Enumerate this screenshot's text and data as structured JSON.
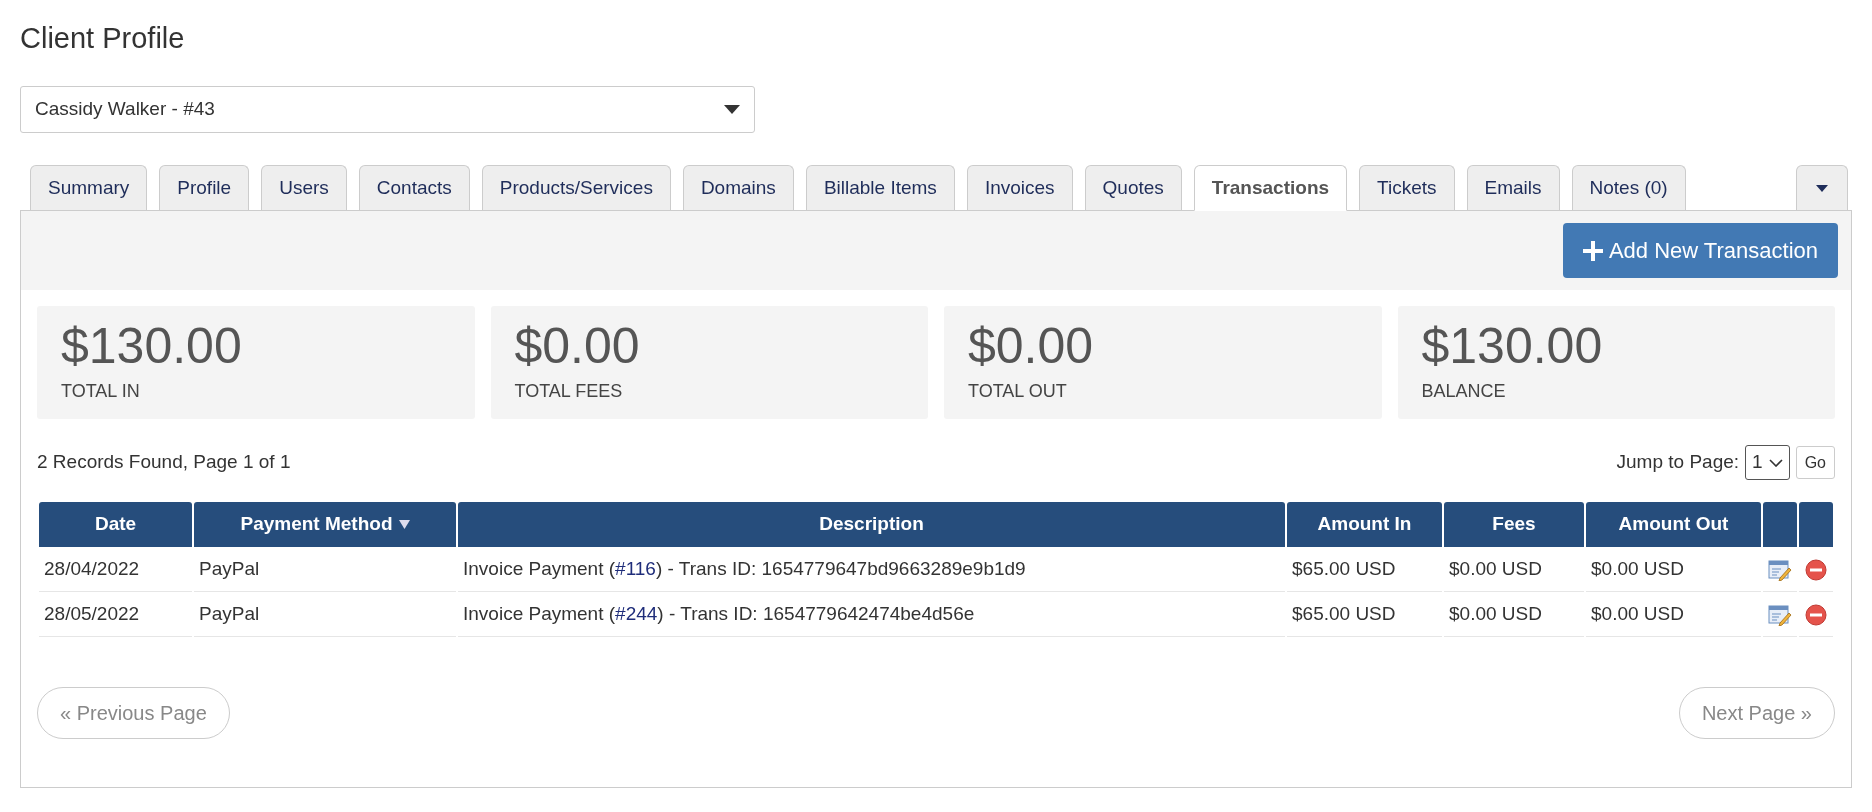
{
  "page_title": "Client Profile",
  "client_select": {
    "value": "Cassidy Walker - #43"
  },
  "tabs": [
    {
      "label": "Summary",
      "selected": false
    },
    {
      "label": "Profile",
      "selected": false
    },
    {
      "label": "Users",
      "selected": false
    },
    {
      "label": "Contacts",
      "selected": false
    },
    {
      "label": "Products/Services",
      "selected": false
    },
    {
      "label": "Domains",
      "selected": false
    },
    {
      "label": "Billable Items",
      "selected": false
    },
    {
      "label": "Invoices",
      "selected": false
    },
    {
      "label": "Quotes",
      "selected": false
    },
    {
      "label": "Transactions",
      "selected": true
    },
    {
      "label": "Tickets",
      "selected": false
    },
    {
      "label": "Emails",
      "selected": false
    },
    {
      "label": "Notes (0)",
      "selected": false
    }
  ],
  "add_button": "Add New Transaction",
  "stats": [
    {
      "value": "$130.00",
      "label": "TOTAL IN"
    },
    {
      "value": "$0.00",
      "label": "TOTAL FEES"
    },
    {
      "value": "$0.00",
      "label": "TOTAL OUT"
    },
    {
      "value": "$130.00",
      "label": "BALANCE"
    }
  ],
  "records_info": "2 Records Found, Page 1 of 1",
  "jump": {
    "label": "Jump to Page:",
    "value": "1",
    "button": "Go"
  },
  "table": {
    "columns": [
      {
        "label": "Date",
        "sorted": false
      },
      {
        "label": "Payment Method",
        "sorted": true
      },
      {
        "label": "Description",
        "sorted": false
      },
      {
        "label": "Amount In",
        "sorted": false
      },
      {
        "label": "Fees",
        "sorted": false
      },
      {
        "label": "Amount Out",
        "sorted": false
      }
    ],
    "rows": [
      {
        "date": "28/04/2022",
        "method": "PayPal",
        "description": {
          "before": "Invoice Payment (",
          "link": "#116",
          "after": ") - Trans ID: 1654779647bd9663289e9b1d9"
        },
        "amount_in": "$65.00 USD",
        "fees": "$0.00 USD",
        "amount_out": "$0.00 USD"
      },
      {
        "date": "28/05/2022",
        "method": "PayPal",
        "description": {
          "before": "Invoice Payment (",
          "link": "#244",
          "after": ") - Trans ID: 1654779642474be4d56e"
        },
        "amount_in": "$65.00 USD",
        "fees": "$0.00 USD",
        "amount_out": "$0.00 USD"
      }
    ]
  },
  "pagination": {
    "previous": "« Previous Page",
    "next": "Next Page »"
  }
}
